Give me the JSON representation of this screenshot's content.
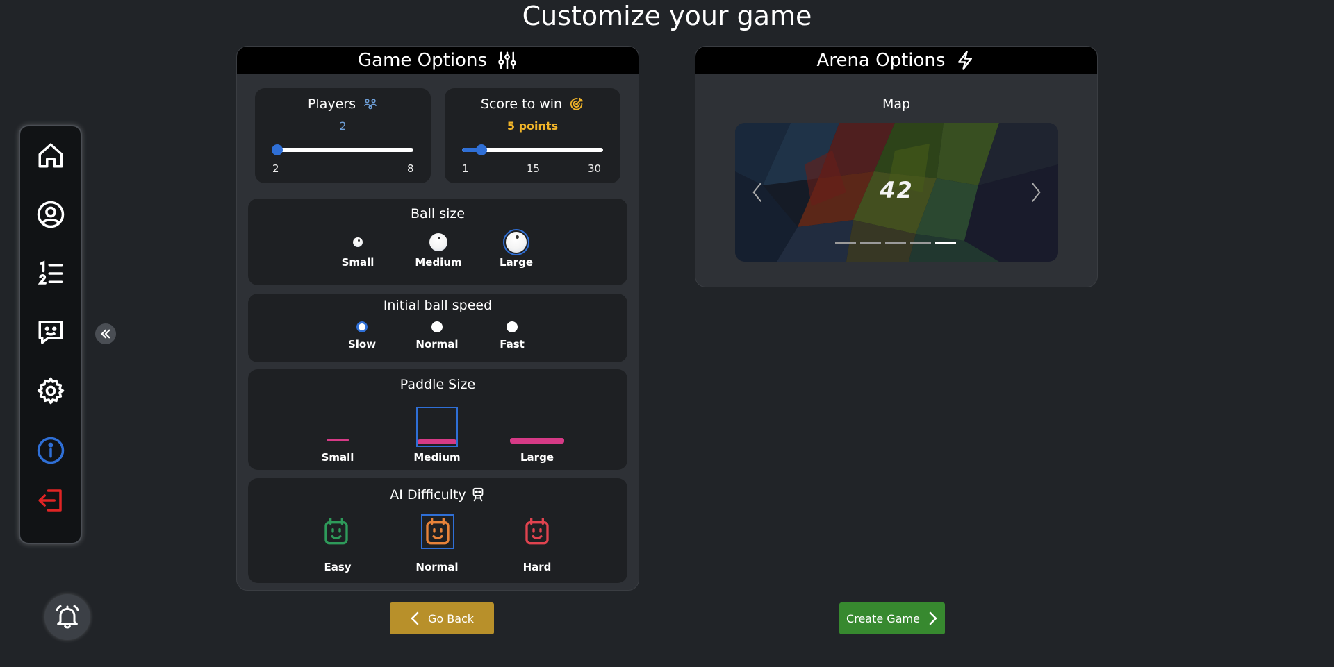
{
  "page": {
    "title": "Customize your game"
  },
  "sidebar": {
    "items": [
      {
        "icon": "home-icon"
      },
      {
        "icon": "profile-icon"
      },
      {
        "icon": "leaderboard-icon"
      },
      {
        "icon": "chat-icon"
      },
      {
        "icon": "gear-icon"
      },
      {
        "icon": "info-icon"
      },
      {
        "icon": "logout-icon"
      }
    ],
    "collapse_icon": "double-chevron-left-icon",
    "notifications_icon": "bell-icon"
  },
  "game_options": {
    "title": "Game Options",
    "players": {
      "label": "Players",
      "value": "2",
      "min_label": "2",
      "max_label": "8",
      "level": 0
    },
    "score": {
      "label": "Score to win",
      "value": "5 points",
      "min_label": "1",
      "mid_label": "15",
      "max_label": "30",
      "level": 0.138
    },
    "ball_size": {
      "title": "Ball size",
      "options": [
        "Small",
        "Medium",
        "Large"
      ],
      "selected": "Large"
    },
    "ball_speed": {
      "title": "Initial ball speed",
      "options": [
        "Slow",
        "Normal",
        "Fast"
      ],
      "selected": "Slow"
    },
    "paddle_size": {
      "title": "Paddle Size",
      "options": [
        "Small",
        "Medium",
        "Large"
      ],
      "selected": "Medium"
    },
    "ai_difficulty": {
      "title": "AI Difficulty",
      "options": [
        "Easy",
        "Normal",
        "Hard"
      ],
      "selected": "Normal"
    }
  },
  "arena_options": {
    "title": "Arena Options",
    "map": {
      "label": "Map",
      "logo_text": "42",
      "slide_count": 5,
      "active_slide": 5
    }
  },
  "actions": {
    "back_label": "Go Back",
    "create_label": "Create Game"
  },
  "colors": {
    "accent": "#2f6fd6",
    "players": "#6e9fd8",
    "score": "#f0b429",
    "paddle": "#d63a86",
    "easy": "#2e9a5a",
    "normal": "#e8833a",
    "hard": "#e0434f",
    "logout": "#e02424",
    "back": "#b8902a",
    "create": "#37892f"
  }
}
